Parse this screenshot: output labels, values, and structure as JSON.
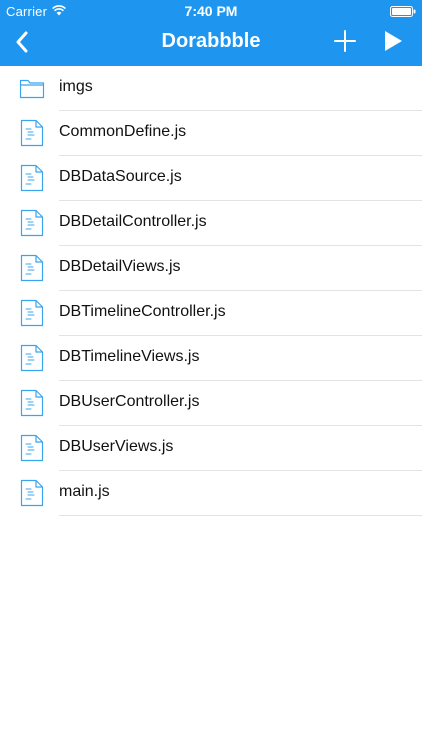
{
  "status_bar": {
    "carrier": "Carrier",
    "time": "7:40 PM"
  },
  "nav": {
    "title": "Dorabbble",
    "back_icon": "chevron-left-icon",
    "add_icon": "plus-icon",
    "run_icon": "play-icon"
  },
  "colors": {
    "accent": "#1e96f0",
    "icon_blue": "#3aa4ee",
    "divider": "#e3e3e3"
  },
  "files": [
    {
      "name": "imgs",
      "type": "folder",
      "icon": "folder-icon"
    },
    {
      "name": "CommonDefine.js",
      "type": "file",
      "icon": "file-icon"
    },
    {
      "name": "DBDataSource.js",
      "type": "file",
      "icon": "file-icon"
    },
    {
      "name": "DBDetailController.js",
      "type": "file",
      "icon": "file-icon"
    },
    {
      "name": "DBDetailViews.js",
      "type": "file",
      "icon": "file-icon"
    },
    {
      "name": "DBTimelineController.js",
      "type": "file",
      "icon": "file-icon"
    },
    {
      "name": "DBTimelineViews.js",
      "type": "file",
      "icon": "file-icon"
    },
    {
      "name": "DBUserController.js",
      "type": "file",
      "icon": "file-icon"
    },
    {
      "name": "DBUserViews.js",
      "type": "file",
      "icon": "file-icon"
    },
    {
      "name": "main.js",
      "type": "file",
      "icon": "file-icon"
    }
  ]
}
